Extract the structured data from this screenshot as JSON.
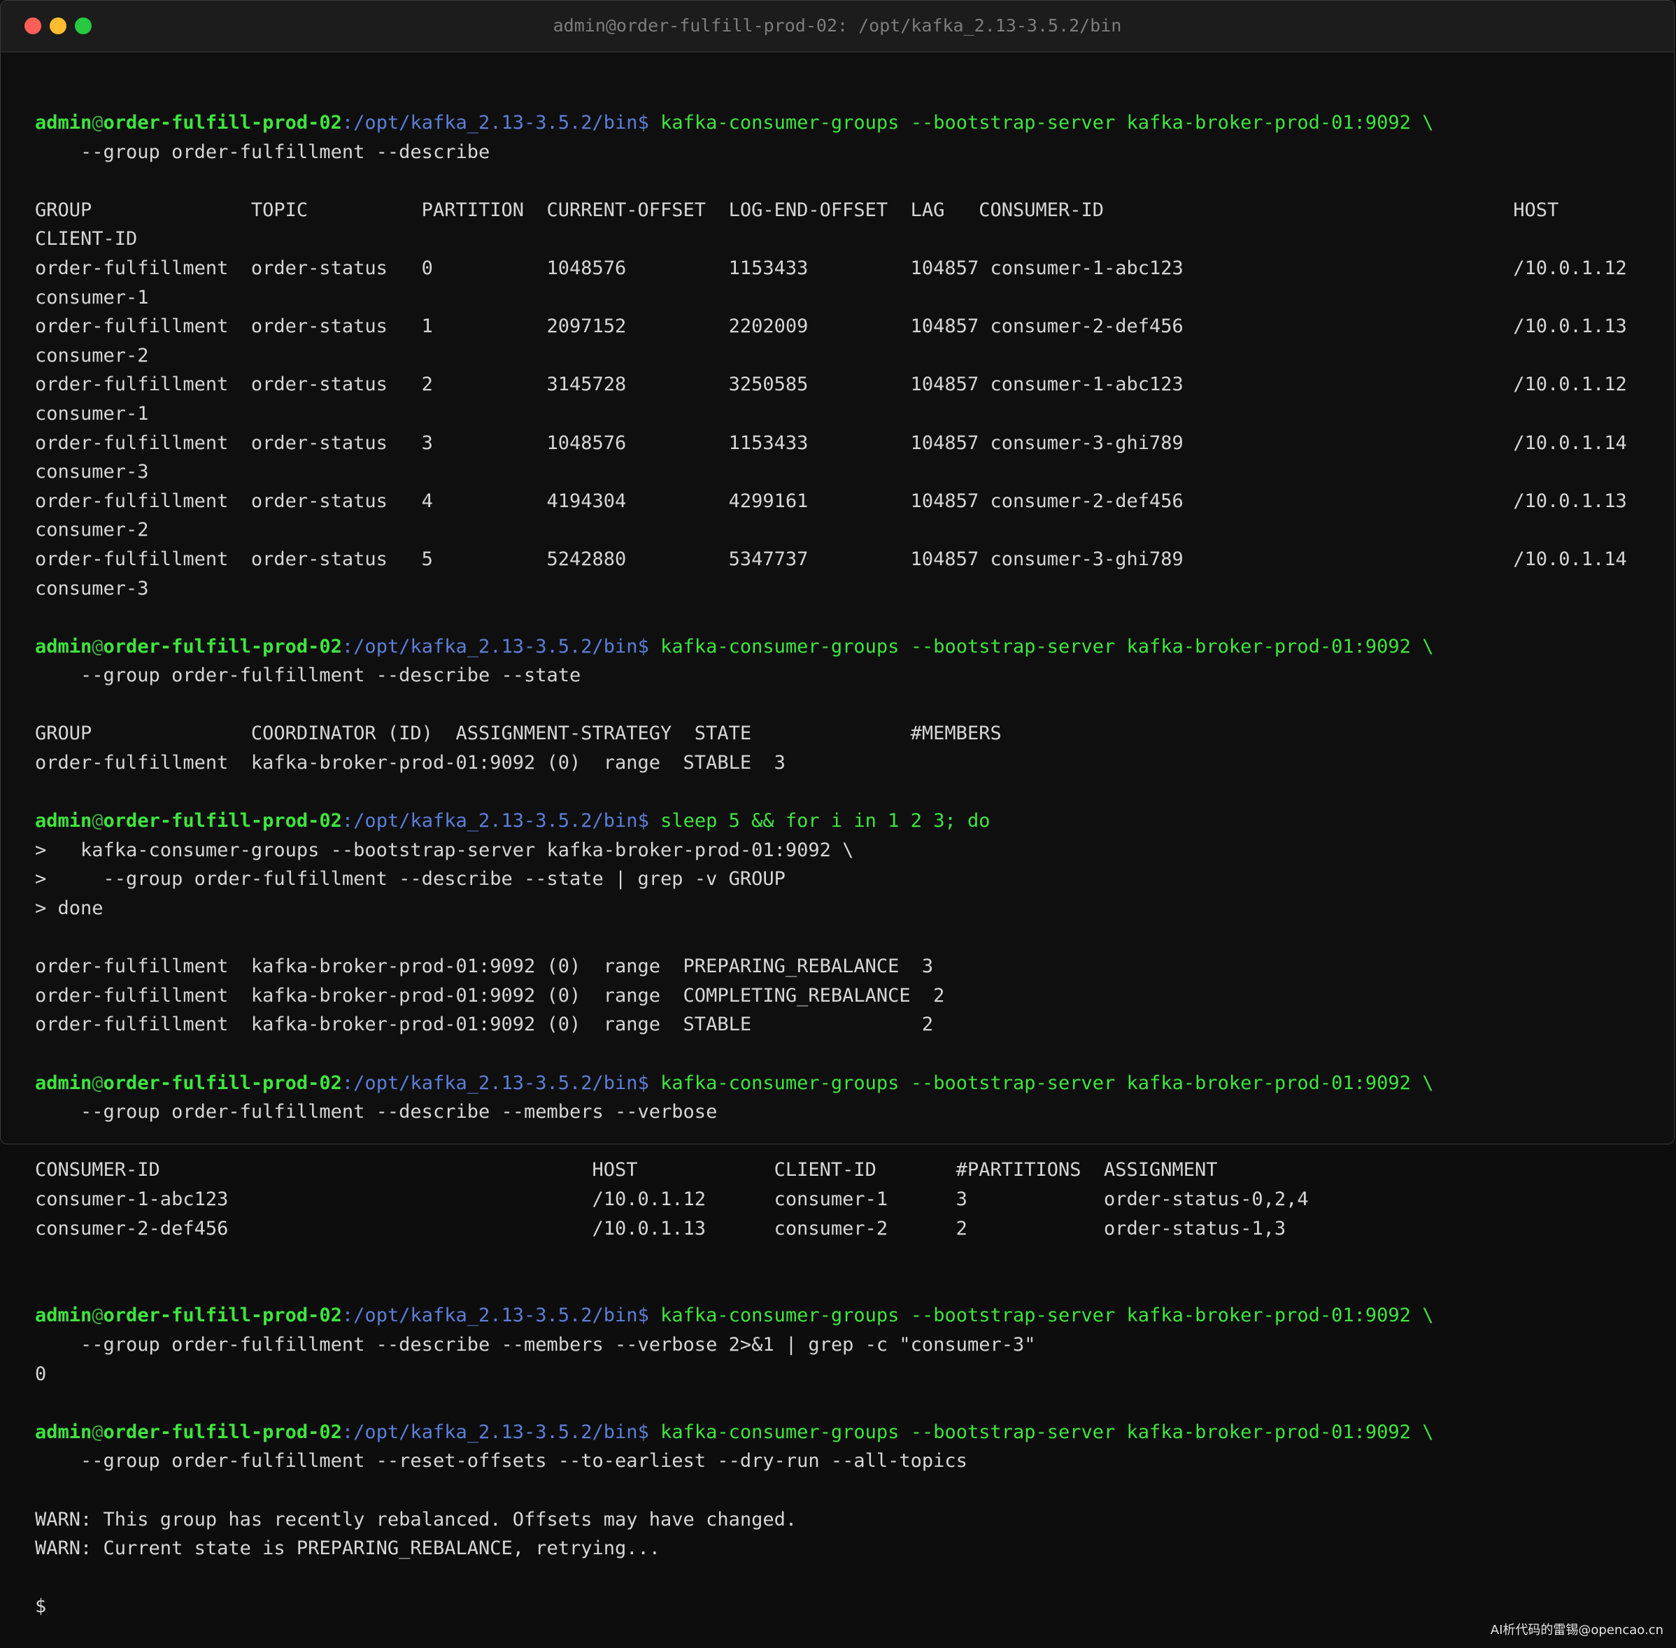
{
  "window": {
    "title": "admin@order-fulfill-prod-02: /opt/kafka_2.13-3.5.2/bin"
  },
  "colors": {
    "prompt_user": "#3ee53e",
    "prompt_path": "#5b7fd8",
    "command": "#3ee53e",
    "output": "#d6d6d6",
    "background": "#0f0f0f"
  },
  "prompt": {
    "user": "admin",
    "at": "@",
    "host": "order-fulfill-prod-02",
    "path": ":/opt/kafka_2.13-3.5.2/bin",
    "dollar": "$ "
  },
  "lines": [
    {
      "t": "prompt",
      "cmd": "kafka-consumer-groups --bootstrap-server kafka-broker-prod-01:9092 \\"
    },
    {
      "t": "out",
      "text": "    --group order-fulfillment --describe"
    },
    {
      "t": "blank"
    },
    {
      "t": "out",
      "text": "GROUP              TOPIC          PARTITION  CURRENT-OFFSET  LOG-END-OFFSET  LAG   CONSUMER-ID                                    HOST"
    },
    {
      "t": "out",
      "text": "CLIENT-ID"
    },
    {
      "t": "out",
      "text": "order-fulfillment  order-status   0          1048576         1153433         104857 consumer-1-abc123                             /10.0.1.12"
    },
    {
      "t": "out",
      "text": "consumer-1"
    },
    {
      "t": "out",
      "text": "order-fulfillment  order-status   1          2097152         2202009         104857 consumer-2-def456                             /10.0.1.13"
    },
    {
      "t": "out",
      "text": "consumer-2"
    },
    {
      "t": "out",
      "text": "order-fulfillment  order-status   2          3145728         3250585         104857 consumer-1-abc123                             /10.0.1.12"
    },
    {
      "t": "out",
      "text": "consumer-1"
    },
    {
      "t": "out",
      "text": "order-fulfillment  order-status   3          1048576         1153433         104857 consumer-3-ghi789                             /10.0.1.14"
    },
    {
      "t": "out",
      "text": "consumer-3"
    },
    {
      "t": "out",
      "text": "order-fulfillment  order-status   4          4194304         4299161         104857 consumer-2-def456                             /10.0.1.13"
    },
    {
      "t": "out",
      "text": "consumer-2"
    },
    {
      "t": "out",
      "text": "order-fulfillment  order-status   5          5242880         5347737         104857 consumer-3-ghi789                             /10.0.1.14"
    },
    {
      "t": "out",
      "text": "consumer-3"
    },
    {
      "t": "blank"
    },
    {
      "t": "prompt",
      "cmd": "kafka-consumer-groups --bootstrap-server kafka-broker-prod-01:9092 \\"
    },
    {
      "t": "out",
      "text": "    --group order-fulfillment --describe --state"
    },
    {
      "t": "blank"
    },
    {
      "t": "out",
      "text": "GROUP              COORDINATOR (ID)  ASSIGNMENT-STRATEGY  STATE              #MEMBERS"
    },
    {
      "t": "out",
      "text": "order-fulfillment  kafka-broker-prod-01:9092 (0)  range  STABLE  3"
    },
    {
      "t": "blank"
    },
    {
      "t": "prompt",
      "cmd": "sleep 5 && for i in 1 2 3; do"
    },
    {
      "t": "out",
      "text": ">   kafka-consumer-groups --bootstrap-server kafka-broker-prod-01:9092 \\"
    },
    {
      "t": "out",
      "text": ">     --group order-fulfillment --describe --state | grep -v GROUP"
    },
    {
      "t": "out",
      "text": "> done"
    },
    {
      "t": "blank"
    },
    {
      "t": "out",
      "text": "order-fulfillment  kafka-broker-prod-01:9092 (0)  range  PREPARING_REBALANCE  3"
    },
    {
      "t": "out",
      "text": "order-fulfillment  kafka-broker-prod-01:9092 (0)  range  COMPLETING_REBALANCE  2"
    },
    {
      "t": "out",
      "text": "order-fulfillment  kafka-broker-prod-01:9092 (0)  range  STABLE               2"
    },
    {
      "t": "blank"
    },
    {
      "t": "prompt",
      "cmd": "kafka-consumer-groups --bootstrap-server kafka-broker-prod-01:9092 \\"
    },
    {
      "t": "out",
      "text": "    --group order-fulfillment --describe --members --verbose"
    },
    {
      "t": "blank"
    },
    {
      "t": "out",
      "text": "CONSUMER-ID                                      HOST            CLIENT-ID       #PARTITIONS  ASSIGNMENT"
    },
    {
      "t": "out",
      "text": "consumer-1-abc123                                /10.0.1.12      consumer-1      3            order-status-0,2,4"
    },
    {
      "t": "out",
      "text": "consumer-2-def456                                /10.0.1.13      consumer-2      2            order-status-1,3"
    },
    {
      "t": "blank"
    },
    {
      "t": "blank"
    },
    {
      "t": "prompt",
      "cmd": "kafka-consumer-groups --bootstrap-server kafka-broker-prod-01:9092 \\"
    },
    {
      "t": "out",
      "text": "    --group order-fulfillment --describe --members --verbose 2>&1 | grep -c \"consumer-3\""
    },
    {
      "t": "out",
      "text": "0"
    },
    {
      "t": "blank"
    },
    {
      "t": "prompt",
      "cmd": "kafka-consumer-groups --bootstrap-server kafka-broker-prod-01:9092 \\"
    },
    {
      "t": "out",
      "text": "    --group order-fulfillment --reset-offsets --to-earliest --dry-run --all-topics"
    },
    {
      "t": "blank"
    },
    {
      "t": "out",
      "text": "WARN: This group has recently rebalanced. Offsets may have changed."
    },
    {
      "t": "out",
      "text": "WARN: Current state is PREPARING_REBALANCE, retrying..."
    },
    {
      "t": "blank"
    },
    {
      "t": "out",
      "text": "$"
    }
  ],
  "watermark": "AI析代码的雷锡@opencao.cn"
}
